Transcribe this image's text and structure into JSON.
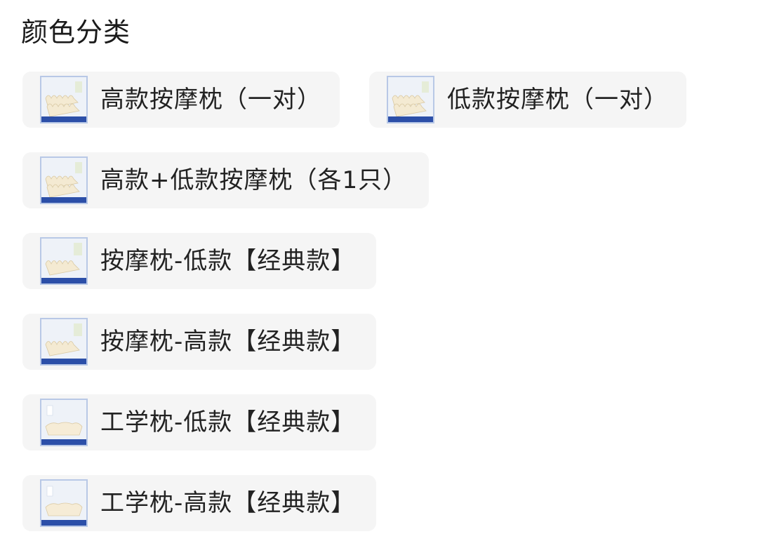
{
  "section": {
    "title": "颜色分类"
  },
  "colors": {
    "chip_bg": "#f5f5f5",
    "thumb_border": "#b8c8e6",
    "thumb_banner": "#2c4fa8",
    "pillow_cream": "#f4ead2"
  },
  "options": [
    {
      "label": "高款按摩枕（一对）",
      "thumb_icon": "massage-pillow-pair-image"
    },
    {
      "label": "低款按摩枕（一对）",
      "thumb_icon": "massage-pillow-pair-image"
    },
    {
      "label": "高款+低款按摩枕（各1只）",
      "thumb_icon": "massage-pillow-pair-image"
    },
    {
      "label": "按摩枕-低款【经典款】",
      "thumb_icon": "massage-pillow-image"
    },
    {
      "label": "按摩枕-高款【经典款】",
      "thumb_icon": "massage-pillow-image"
    },
    {
      "label": "工学枕-低款【经典款】",
      "thumb_icon": "ergonomic-pillow-image"
    },
    {
      "label": "工学枕-高款【经典款】",
      "thumb_icon": "ergonomic-pillow-image"
    }
  ]
}
